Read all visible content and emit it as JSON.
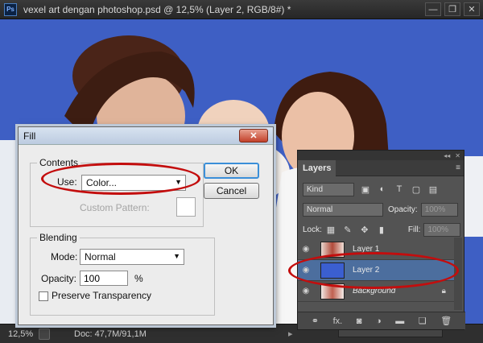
{
  "window": {
    "app_icon": "Ps",
    "title": "vexel art dengan photoshop.psd @ 12,5% (Layer 2, RGB/8#) *",
    "minimize": "—",
    "restore": "❐",
    "close": "✕"
  },
  "status": {
    "zoom": "12,5%",
    "doc": "Doc: 47,7M/91,1M",
    "arrow": "▸"
  },
  "dialog": {
    "title": "Fill",
    "close": "✕",
    "contents_label": "Contents",
    "use_label": "Use:",
    "use_value": "Color...",
    "custom_pattern_label": "Custom Pattern:",
    "ok_label": "OK",
    "cancel_label": "Cancel",
    "blending_label": "Blending",
    "mode_label": "Mode:",
    "mode_value": "Normal",
    "opacity_label": "Opacity:",
    "opacity_value": "100",
    "percent": "%",
    "preserve_label": "Preserve Transparency"
  },
  "layers_panel": {
    "collapse": "◂◂",
    "close": "✕",
    "tab": "Layers",
    "kind_label": "Kind",
    "blend_mode": "Normal",
    "opacity_label": "Opacity:",
    "opacity_value": "100%",
    "lock_label": "Lock:",
    "fill_label": "Fill:",
    "fill_value": "100%",
    "layers": [
      {
        "name": "Layer 1",
        "selected": false,
        "italic": false
      },
      {
        "name": "Layer 2",
        "selected": true,
        "italic": false
      },
      {
        "name": "Background",
        "selected": false,
        "italic": true
      }
    ],
    "filter_icons": [
      "image-filter-icon",
      "adjustment-filter-icon",
      "type-filter-icon",
      "shape-filter-icon",
      "smart-object-filter-icon"
    ],
    "bottom_icons": [
      "link-icon",
      "fx-icon",
      "mask-icon",
      "adjustment-icon",
      "group-folder-icon",
      "new-layer-icon",
      "trash-icon"
    ],
    "fx_label": "fx."
  },
  "colors": {
    "canvas_blue": "#3e5fc4",
    "layer2_fill": "#3b5fd0",
    "annotation_red": "#c30d0d",
    "selected_layer": "#4c6e9e"
  }
}
